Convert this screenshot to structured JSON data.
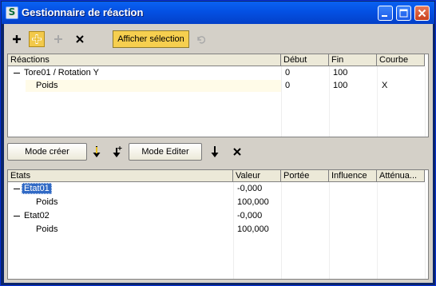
{
  "window": {
    "title": "Gestionnaire de réaction"
  },
  "toolbar": {
    "add_icon": "plus-icon",
    "add_selected_icon": "plus-yellow-icon",
    "add_disabled_icon": "plus-gray-icon",
    "delete_icon": "x-icon",
    "show_selection_label": "Afficher sélection",
    "refresh_icon": "undo-icon"
  },
  "reactions": {
    "columns": [
      "Réactions",
      "Début",
      "Fin",
      "Courbe"
    ],
    "rows": [
      {
        "name": "Tore01 / Rotation Y",
        "start": "0",
        "end": "100",
        "curve": ""
      },
      {
        "name": "Poids",
        "start": "0",
        "end": "100",
        "curve": "X"
      }
    ]
  },
  "states_toolbar": {
    "create_mode_label": "Mode créer",
    "edit_mode_label": "Mode Editer"
  },
  "states": {
    "columns": [
      "Etats",
      "Valeur",
      "Portée",
      "Influence",
      "Atténua..."
    ],
    "rows": [
      {
        "name": "Etat01",
        "value": "-0,000"
      },
      {
        "name": "Poids",
        "value": "100,000"
      },
      {
        "name": "Etat02",
        "value": "-0,000"
      },
      {
        "name": "Poids",
        "value": "100,000"
      }
    ]
  },
  "colors": {
    "accent": "#f6cf4f",
    "title_bar": "#0450e3",
    "selection": "#316ac5"
  }
}
